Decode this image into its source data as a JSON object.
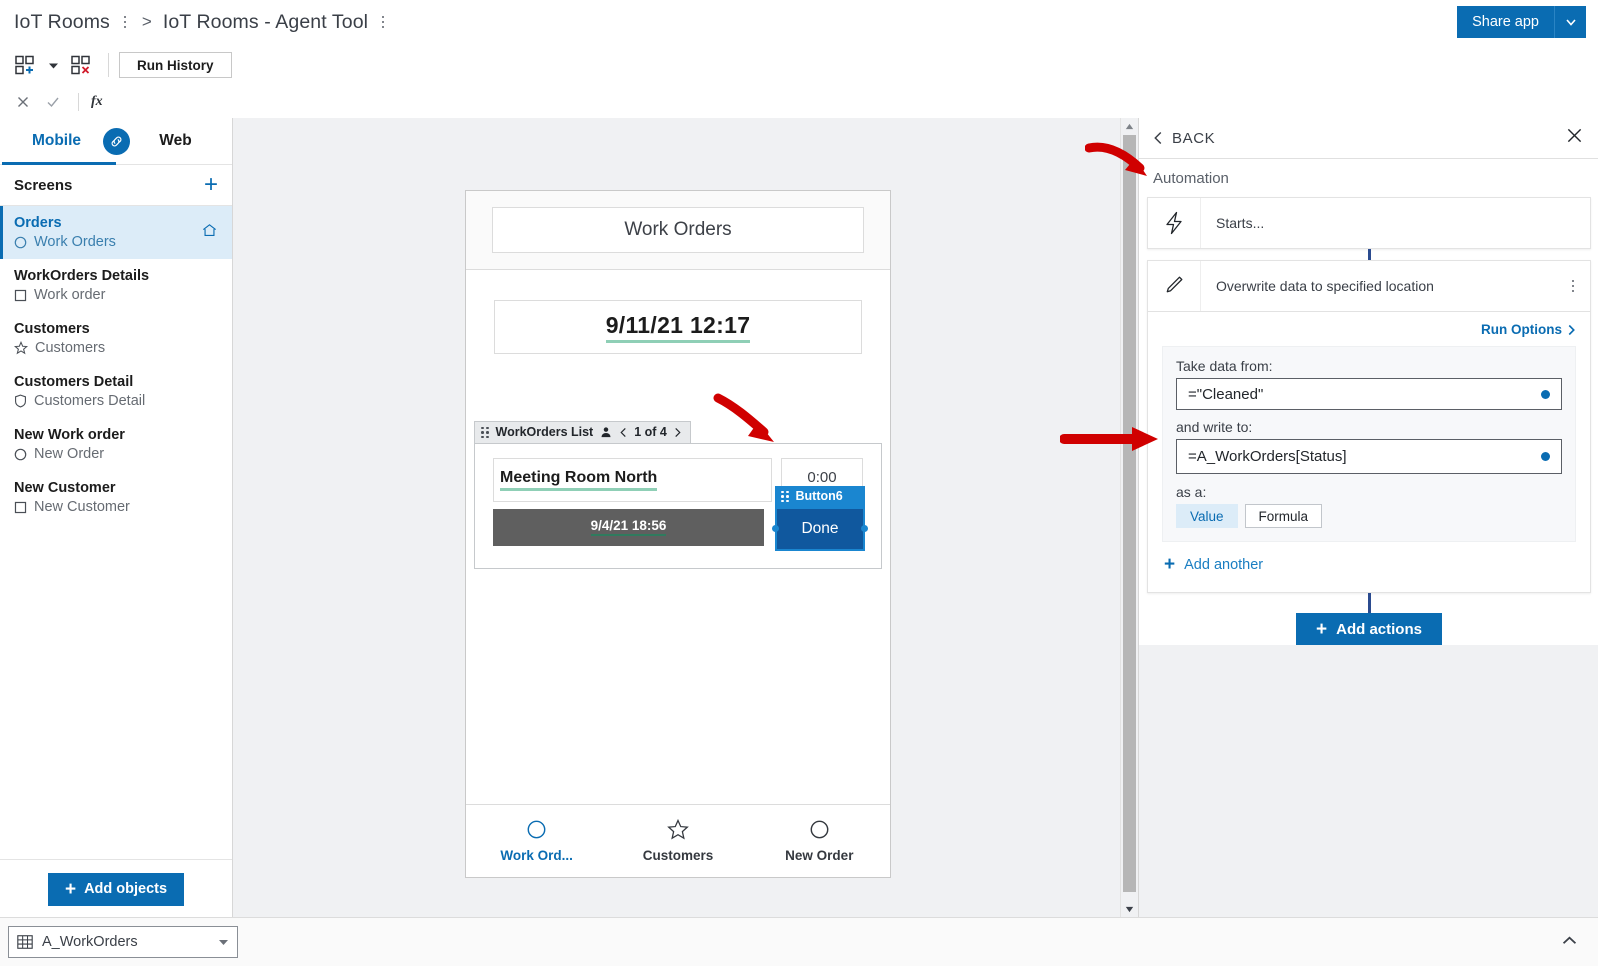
{
  "titlebar": {
    "breadcrumb_root": "IoT Rooms",
    "breadcrumb_sep": ">",
    "breadcrumb_current": "IoT Rooms - Agent Tool",
    "share_label": "Share app",
    "share_caret_icon": "chevron-down-icon",
    "kebab_icon": "kebab-menu-icon"
  },
  "toolbar": {
    "add_screen_icon": "add-screen-icon",
    "add_screen_caret_icon": "chevron-down-icon",
    "delete_screen_icon": "delete-screen-icon",
    "run_history_label": "Run History"
  },
  "formulabar": {
    "cancel_icon": "close-icon",
    "confirm_icon": "check-icon",
    "fx_label": "fx"
  },
  "sidebar": {
    "tab_mobile": "Mobile",
    "tab_web": "Web",
    "link_icon": "link-icon",
    "screens_title": "Screens",
    "add_screen_icon": "plus-icon",
    "home_icon": "home-icon",
    "add_objects_label": "Add objects",
    "add_objects_plus": "+",
    "items": [
      {
        "name": "Orders",
        "sub": "Work Orders",
        "icon": "circle-icon",
        "selected": true,
        "home": true
      },
      {
        "name": "WorkOrders Details",
        "sub": "Work order",
        "icon": "square-icon",
        "selected": false,
        "home": false
      },
      {
        "name": "Customers",
        "sub": "Customers",
        "icon": "star-icon",
        "selected": false,
        "home": false
      },
      {
        "name": "Customers Detail",
        "sub": "Customers Detail",
        "icon": "shield-icon",
        "selected": false,
        "home": false
      },
      {
        "name": "New Work order",
        "sub": "New Order",
        "icon": "circle-icon",
        "selected": false,
        "home": false
      },
      {
        "name": "New Customer",
        "sub": "New Customer",
        "icon": "square-icon",
        "selected": false,
        "home": false
      }
    ]
  },
  "canvas": {
    "phone": {
      "title": "Work Orders",
      "date_field": "9/11/21 12:17",
      "list": {
        "tab_label": "WorkOrders List",
        "person_icon": "person-icon",
        "prev_icon": "chevron-left-icon",
        "pager": "1 of 4",
        "next_icon": "chevron-right-icon",
        "row_name": "Meeting Room North",
        "row_time": "0:00",
        "row_date": "9/4/21 18:56",
        "selected_widget_label": "Button6",
        "selected_widget_text": "Done"
      },
      "nav": [
        {
          "label": "Work Ord...",
          "icon": "circle-icon",
          "active": true
        },
        {
          "label": "Customers",
          "icon": "star-icon",
          "active": false
        },
        {
          "label": "New Order",
          "icon": "circle-icon",
          "active": false
        }
      ]
    },
    "scroll_up_icon": "scroll-up-arrow-icon",
    "scroll_down_icon": "scroll-down-arrow-icon"
  },
  "right_panel": {
    "back_label": "BACK",
    "back_icon": "chevron-left-icon",
    "close_icon": "close-icon",
    "section_label": "Automation",
    "trigger_row": {
      "icon": "lightning-bolt-icon",
      "text": "Starts..."
    },
    "action_row": {
      "icon": "pencil-icon",
      "text": "Overwrite data to specified location",
      "menu_icon": "kebab-menu-icon"
    },
    "run_options_label": "Run Options",
    "run_options_icon": "chevron-right-icon",
    "take_data_from_label": "Take data from:",
    "take_data_from_value": "=\"Cleaned\"",
    "and_write_to_label": "and write to:",
    "and_write_to_value": "=A_WorkOrders[Status]",
    "as_a_label": "as a:",
    "seg_value_label": "Value",
    "seg_formula_label": "Formula",
    "add_another_label": "Add another",
    "add_another_plus": "+",
    "add_actions_label": "Add actions",
    "add_actions_plus": "+"
  },
  "bottombar": {
    "table_icon": "table-icon",
    "table_name": "A_WorkOrders",
    "table_caret_icon": "caret-down-icon",
    "expand_icon": "chevron-up-icon"
  },
  "colors": {
    "accent": "#0a6cb2",
    "selected_widget_label_bg": "#1a86d0",
    "selected_widget_body_bg": "#10589e",
    "canvas_bg": "#f0f1f3",
    "annotation_arrow": "#d00000",
    "underline_green": "#8fcfb6",
    "gray_row": "#5f5f5f"
  }
}
